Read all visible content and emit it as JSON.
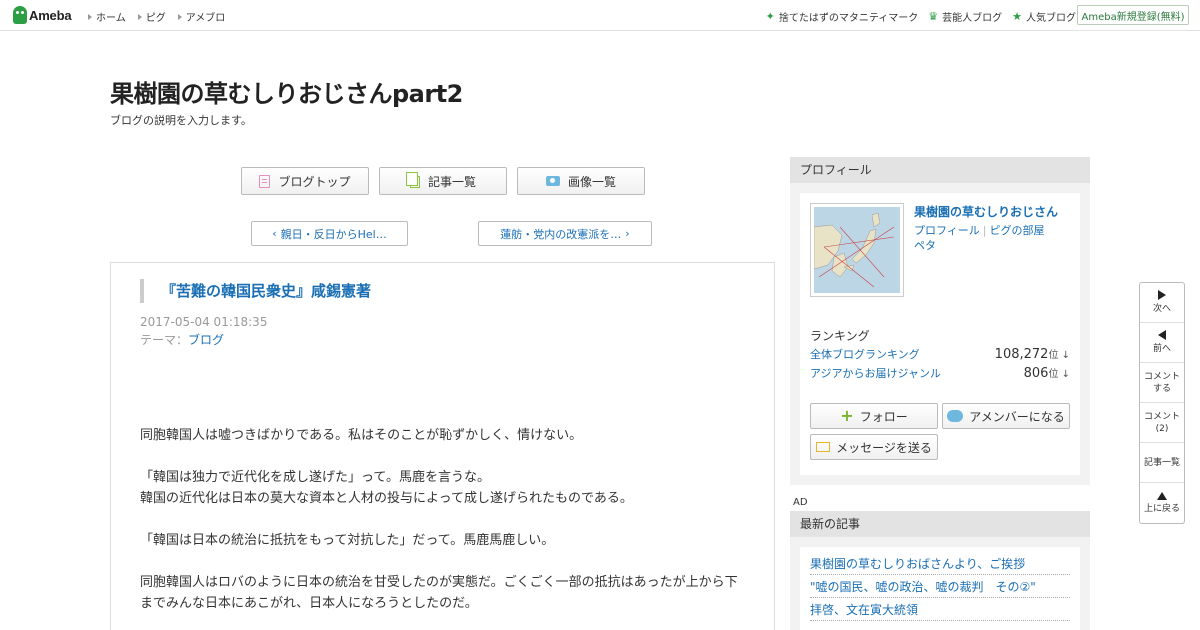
{
  "topbar": {
    "logo": "Ameba",
    "nav": [
      "ホーム",
      "ピグ",
      "アメブロ"
    ],
    "right_links": [
      {
        "icon": "sparkle-icon",
        "label": "捨てたはずのマタニティマーク"
      },
      {
        "icon": "crown-icon",
        "label": "芸能人ブログ"
      },
      {
        "icon": "star-icon",
        "label": "人気ブログ"
      }
    ],
    "register": "Ameba新規登録(無料)"
  },
  "blog": {
    "title": "果樹園の草むしりおじさんpart2",
    "description": "ブログの説明を入力します。"
  },
  "buttons": {
    "top": "ブログトップ",
    "list": "記事一覧",
    "images": "画像一覧"
  },
  "pager": {
    "prev": "親日・反日からHel…",
    "next": "蓮舫・党内の改憲派を…"
  },
  "entry": {
    "title": "『苦難の韓国民衆史』咸錫憲著",
    "date": "2017-05-04 01:18:35",
    "theme_label": "テーマ：",
    "theme": "ブログ",
    "paragraphs": [
      "同胞韓国人は嘘つきばかりである。私はそのことが恥ずかしく、情けない。",
      "「韓国は独力で近代化を成し遂げた」って。馬鹿を言うな。",
      "韓国の近代化は日本の莫大な資本と人材の投与によって成し遂げられたものである。",
      "「韓国は日本の統治に抵抗をもって対抗した」だって。馬鹿馬鹿しい。",
      "同胞韓国人はロバのように日本の統治を甘受したのが実態だ。ごくごく一部の抵抗はあったが上から下までみんな日本にあこがれ、日本人になろうとしたのだ。"
    ]
  },
  "profile": {
    "header": "プロフィール",
    "name": "果樹園の草むしりおじさん",
    "link1": "プロフィール",
    "link2": "ピグの部屋",
    "link3": "ペタ",
    "ranking_label": "ランキング",
    "rankings": [
      {
        "name": "全体ブログランキング",
        "value": "108,272",
        "unit": "位"
      },
      {
        "name": "アジアからお届けジャンル",
        "value": "806",
        "unit": "位"
      }
    ],
    "follow": "フォロー",
    "amember": "アメンバーになる",
    "message": "メッセージを送る"
  },
  "ad_label": "AD",
  "recent": {
    "header": "最新の記事",
    "items": [
      "果樹園の草むしりおばさんより、ご挨拶",
      "\"嘘の国民、嘘の政治、嘘の裁判　その②\"",
      "拝啓、文在寅大統領"
    ]
  },
  "floatnav": {
    "next": "次へ",
    "prev": "前へ",
    "comment_line1": "コメント",
    "comment_line2": "する",
    "comments_line1": "コメント",
    "comments_line2": "(2)",
    "list": "記事一覧",
    "top": "上に戻る"
  }
}
